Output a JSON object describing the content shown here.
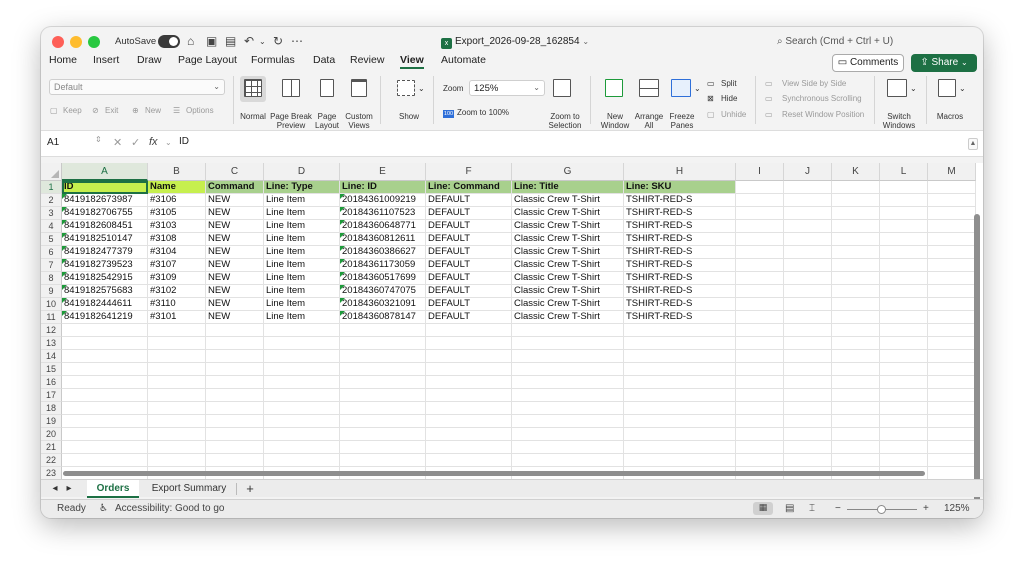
{
  "titlebar": {
    "autosave": "AutoSave",
    "doc_title": "Export_2026-09-28_162854",
    "search": "Search (Cmd + Ctrl + U)"
  },
  "tabs": [
    "Home",
    "Insert",
    "Draw",
    "Page Layout",
    "Formulas",
    "Data",
    "Review",
    "View",
    "Automate"
  ],
  "active_tab": "View",
  "comments_label": "Comments",
  "share_label": "Share",
  "ribbon": {
    "style_default": "Default",
    "keep": "Keep",
    "exit": "Exit",
    "new": "New",
    "options": "Options",
    "normal": "Normal",
    "page_break_preview": "Page Break Preview",
    "page_layout": "Page Layout",
    "custom_views": "Custom Views",
    "show": "Show",
    "zoom_label": "Zoom",
    "zoom_value": "125%",
    "zoom_100": "Zoom to 100%",
    "zoom_selection": "Zoom to Selection",
    "new_window": "New Window",
    "arrange_all": "Arrange All",
    "freeze_panes": "Freeze Panes",
    "split": "Split",
    "hide": "Hide",
    "unhide": "Unhide",
    "view_side_by_side": "View Side by Side",
    "sync_scrolling": "Synchronous Scrolling",
    "reset_window": "Reset Window Position",
    "switch_windows": "Switch Windows",
    "macros": "Macros"
  },
  "formula_bar": {
    "name_box": "A1",
    "fx": "fx",
    "content": "ID"
  },
  "grid": {
    "columns": [
      "A",
      "B",
      "C",
      "D",
      "E",
      "F",
      "G",
      "H",
      "I",
      "J",
      "K",
      "L",
      "M"
    ],
    "row_numbers": [
      "1",
      "2",
      "3",
      "4",
      "5",
      "6",
      "7",
      "8",
      "9",
      "10",
      "11",
      "12",
      "13",
      "14",
      "15",
      "16",
      "17",
      "18",
      "19",
      "20",
      "21",
      "22",
      "23"
    ],
    "header_row": [
      "ID",
      "Name",
      "Command",
      "Line: Type",
      "Line: ID",
      "Line: Command",
      "Line: Title",
      "Line: SKU"
    ],
    "rows": [
      [
        "8419182673987",
        "#3106",
        "NEW",
        "Line Item",
        "20184361009219",
        "DEFAULT",
        "Classic Crew T-Shirt",
        "TSHIRT-RED-S"
      ],
      [
        "8419182706755",
        "#3105",
        "NEW",
        "Line Item",
        "20184361107523",
        "DEFAULT",
        "Classic Crew T-Shirt",
        "TSHIRT-RED-S"
      ],
      [
        "8419182608451",
        "#3103",
        "NEW",
        "Line Item",
        "20184360648771",
        "DEFAULT",
        "Classic Crew T-Shirt",
        "TSHIRT-RED-S"
      ],
      [
        "8419182510147",
        "#3108",
        "NEW",
        "Line Item",
        "20184360812611",
        "DEFAULT",
        "Classic Crew T-Shirt",
        "TSHIRT-RED-S"
      ],
      [
        "8419182477379",
        "#3104",
        "NEW",
        "Line Item",
        "20184360386627",
        "DEFAULT",
        "Classic Crew T-Shirt",
        "TSHIRT-RED-S"
      ],
      [
        "8419182739523",
        "#3107",
        "NEW",
        "Line Item",
        "20184361173059",
        "DEFAULT",
        "Classic Crew T-Shirt",
        "TSHIRT-RED-S"
      ],
      [
        "8419182542915",
        "#3109",
        "NEW",
        "Line Item",
        "20184360517699",
        "DEFAULT",
        "Classic Crew T-Shirt",
        "TSHIRT-RED-S"
      ],
      [
        "8419182575683",
        "#3102",
        "NEW",
        "Line Item",
        "20184360747075",
        "DEFAULT",
        "Classic Crew T-Shirt",
        "TSHIRT-RED-S"
      ],
      [
        "8419182444611",
        "#3110",
        "NEW",
        "Line Item",
        "20184360321091",
        "DEFAULT",
        "Classic Crew T-Shirt",
        "TSHIRT-RED-S"
      ],
      [
        "8419182641219",
        "#3101",
        "NEW",
        "Line Item",
        "20184360878147",
        "DEFAULT",
        "Classic Crew T-Shirt",
        "TSHIRT-RED-S"
      ]
    ]
  },
  "sheets": [
    "Orders",
    "Export Summary"
  ],
  "active_sheet": "Orders",
  "status": {
    "ready": "Ready",
    "accessibility": "Accessibility: Good to go",
    "zoom": "125%",
    "minus": "−",
    "plus": "+"
  },
  "colors": {
    "accent": "#1d7044",
    "header_green": "#a8d08d",
    "header_yellow": "#c6ef4e"
  }
}
